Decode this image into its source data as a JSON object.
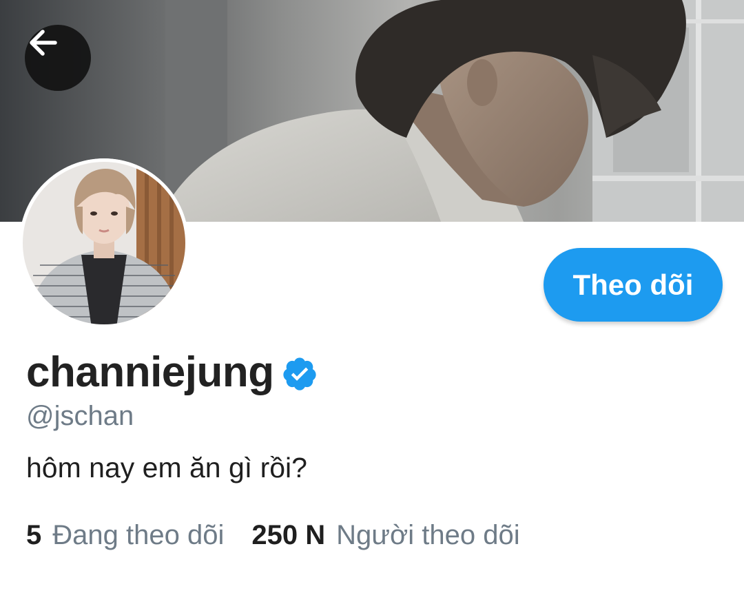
{
  "header": {
    "back_icon": "arrow-left-icon"
  },
  "profile": {
    "display_name": "channiejung",
    "verified_icon": "verified-badge-icon",
    "handle": "@jschan",
    "bio": "hôm nay em ăn gì rồi?",
    "follow_label": "Theo dõi"
  },
  "stats": {
    "following_count": "5",
    "following_label": "Đang theo dõi",
    "followers_count": "250 N",
    "followers_label": "Người theo dõi"
  },
  "colors": {
    "accent": "#1d9bf0",
    "text_primary": "#1f1f1f",
    "text_secondary": "#6e7b87"
  }
}
